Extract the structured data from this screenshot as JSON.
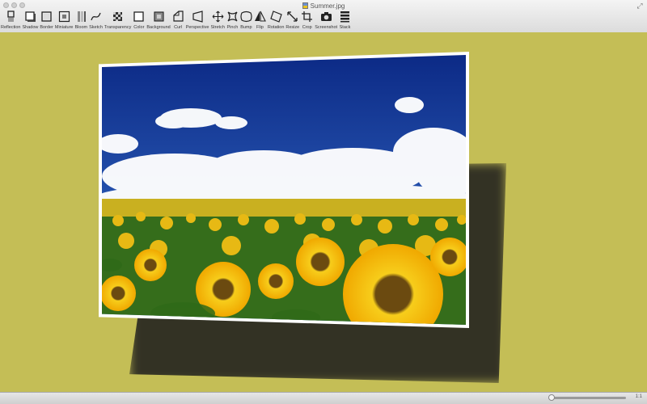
{
  "window": {
    "title": "Summer.jpg"
  },
  "toolbar": {
    "items": [
      {
        "label": "Reflection",
        "icon": "reflection-icon"
      },
      {
        "label": "Shadow",
        "icon": "shadow-icon"
      },
      {
        "label": "Border",
        "icon": "border-icon"
      },
      {
        "label": "Miniature",
        "icon": "miniature-icon"
      },
      {
        "label": "Bloom",
        "icon": "bloom-icon"
      },
      {
        "label": "Sketch",
        "icon": "sketch-icon"
      },
      {
        "label": "Transparency",
        "icon": "transparency-icon"
      },
      {
        "label": "Color",
        "icon": "color-icon"
      },
      {
        "label": "Background",
        "icon": "background-icon"
      },
      {
        "label": "Curl",
        "icon": "curl-icon"
      },
      {
        "label": "Perspective",
        "icon": "perspective-icon"
      },
      {
        "label": "Stretch",
        "icon": "stretch-icon"
      },
      {
        "label": "Pinch",
        "icon": "pinch-icon"
      },
      {
        "label": "Bump",
        "icon": "bump-icon"
      },
      {
        "label": "Flip",
        "icon": "flip-icon"
      },
      {
        "label": "Rotation",
        "icon": "rotation-icon"
      },
      {
        "label": "Resize",
        "icon": "resize-icon"
      },
      {
        "label": "Crop",
        "icon": "crop-icon"
      },
      {
        "label": "Screenshot",
        "icon": "camera-icon"
      },
      {
        "label": "Stack",
        "icon": "stack-icon"
      }
    ]
  },
  "canvas": {
    "background_color": "#c4be56",
    "shadow_color": "#2c2b22",
    "photo_description_colors": {
      "sky": "#1d3f9e",
      "cloud": "#ffffff",
      "field": "#3d7a1f",
      "sunflower": "#f2c10f"
    }
  },
  "statusbar": {
    "zoom_label": "1:1",
    "zoom_fraction": 0.0
  }
}
